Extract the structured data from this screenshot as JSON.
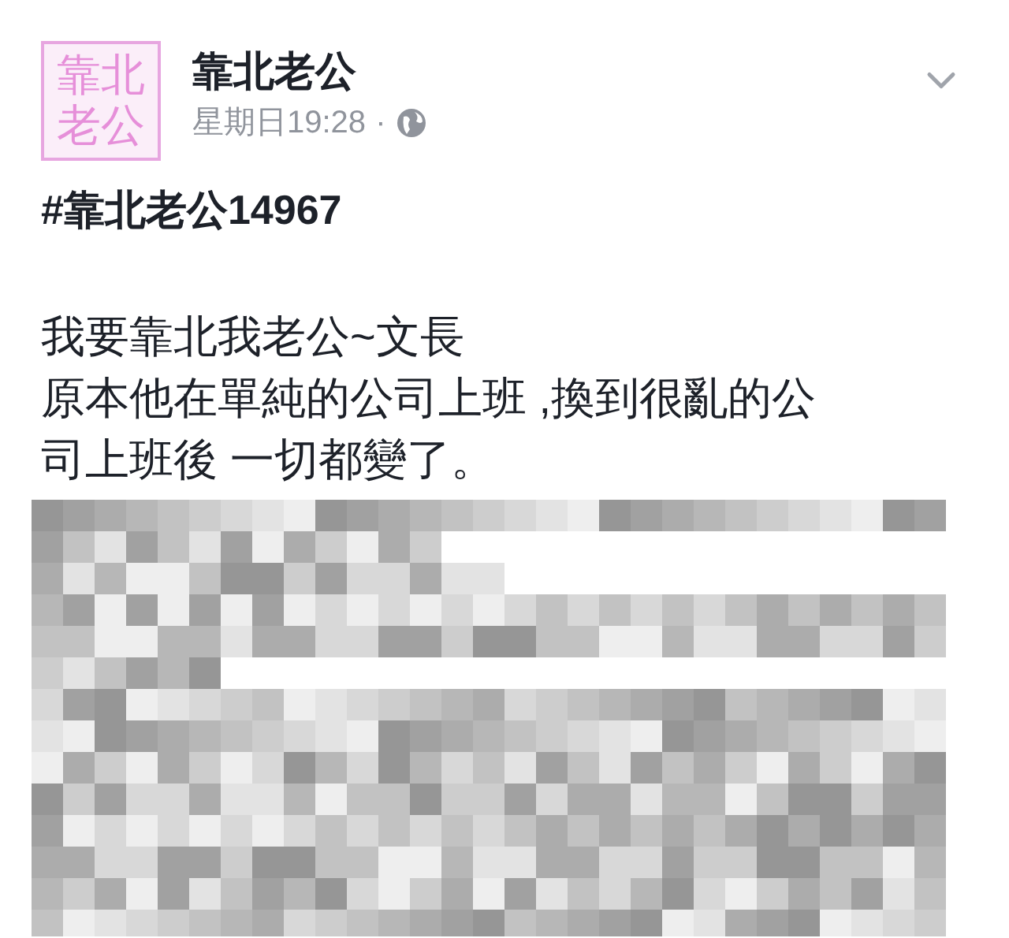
{
  "post": {
    "avatar_text": [
      "靠北",
      "老公"
    ],
    "author": "靠北老公",
    "time": "星期日19:28",
    "separator": "·",
    "hashtag": "#靠北老公14967",
    "lines": [
      "我要靠北我老公~文長",
      "原本他在單純的公司上班 ,換到很亂的公",
      "司上班後 一切都變了。"
    ]
  }
}
